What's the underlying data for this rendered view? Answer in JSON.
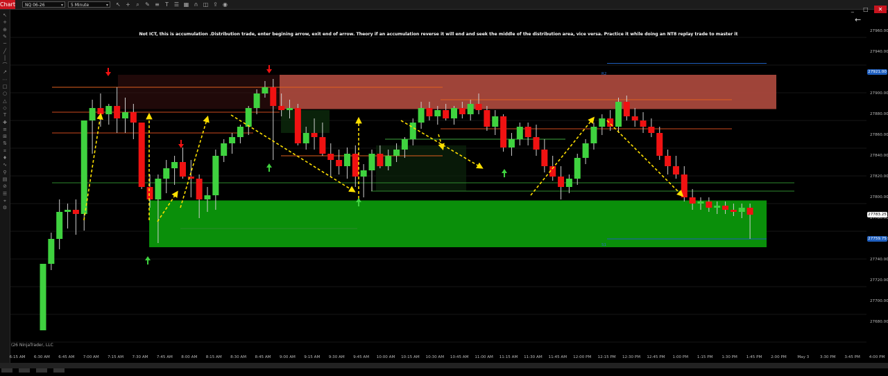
{
  "toolbar": {
    "tab_label": "Chart",
    "instrument": "NQ 06-26",
    "interval": "5 Minute",
    "icons": [
      "cursor-icon",
      "crosshair-icon",
      "zoom-icon",
      "pencil-icon",
      "properties-icon",
      "text-icon",
      "list-icon",
      "grid-icon",
      "magnet-icon",
      "layers-icon",
      "export-icon",
      "camera-icon"
    ]
  },
  "window_buttons": {
    "minimize": "_",
    "maximize": "□",
    "close": "✕"
  },
  "annotation": "Not ICT, this is accumulation .Distribution trade, enter begining arrow, exit end of arrow. Theory if an accumulation reverse it will end and seek the middle of the distribution area, vice versa. Practice it while doing  an NT8 replay trade to  master it",
  "copyright": "(26 NinjaTrader, LLC",
  "level_labels": {
    "r2": "R2",
    "s1": "S1"
  },
  "yaxis": {
    "ticks": [
      "27960.00",
      "27940.00",
      "27900.00",
      "27880.00",
      "27860.00",
      "27840.00",
      "27820.00",
      "27800.00",
      "27780.00",
      "27760.00",
      "27740.00",
      "27720.00",
      "27700.00",
      "27680.00"
    ],
    "price_flags": {
      "r2": {
        "text": "27921.00",
        "color": "#1f5fbf"
      },
      "last": {
        "text": "27783.25",
        "color": "#ffffff"
      },
      "s1": {
        "text": "27759.75",
        "color": "#1f5fbf"
      }
    }
  },
  "xaxis": {
    "labels": [
      "6:15 AM",
      "6:30 AM",
      "6:45 AM",
      "7:00 AM",
      "7:15 AM",
      "7:30 AM",
      "7:45 AM",
      "8:00 AM",
      "8:15 AM",
      "8:30 AM",
      "8:45 AM",
      "9:00 AM",
      "9:15 AM",
      "9:30 AM",
      "9:45 AM",
      "10:00 AM",
      "10:15 AM",
      "10:30 AM",
      "10:45 AM",
      "11:00 AM",
      "11:15 AM",
      "11:30 AM",
      "11:45 AM",
      "12:00 PM",
      "12:15 PM",
      "12:30 PM",
      "12:45 PM",
      "1:00 PM",
      "1:15 PM",
      "1:30 PM",
      "1:45 PM",
      "2:00 PM",
      "May 3",
      "3:30 PM",
      "3:45 PM",
      "4:00 PM"
    ]
  },
  "colors": {
    "up": "#3fd23f",
    "down": "#f01212",
    "zone_red": "#a8483c",
    "zone_green": "#0a8f0a",
    "arrow_yellow": "#ffe000"
  },
  "chart_data": {
    "type": "candlestick",
    "instrument": "NQ 06-26",
    "interval": "5 Minute",
    "ylim": [
      27670,
      27980
    ],
    "candles": [
      {
        "t": "6:30 AM",
        "o": 27672,
        "h": 27736,
        "l": 27672,
        "c": 27736
      },
      {
        "t": "6:35 AM",
        "o": 27736,
        "h": 27766,
        "l": 27730,
        "c": 27760
      },
      {
        "t": "6:40 AM",
        "o": 27760,
        "h": 27798,
        "l": 27750,
        "c": 27786
      },
      {
        "t": "6:45 AM",
        "o": 27786,
        "h": 27794,
        "l": 27770,
        "c": 27788
      },
      {
        "t": "6:50 AM",
        "o": 27788,
        "h": 27798,
        "l": 27764,
        "c": 27784
      },
      {
        "t": "6:55 AM",
        "o": 27784,
        "h": 27846,
        "l": 27768,
        "c": 27874
      },
      {
        "t": "7:00 AM",
        "o": 27874,
        "h": 27894,
        "l": 27842,
        "c": 27886
      },
      {
        "t": "7:05 AM",
        "o": 27886,
        "h": 27900,
        "l": 27868,
        "c": 27880
      },
      {
        "t": "7:10 AM",
        "o": 27880,
        "h": 27890,
        "l": 27870,
        "c": 27888
      },
      {
        "t": "7:15 AM",
        "o": 27888,
        "h": 27906,
        "l": 27862,
        "c": 27876
      },
      {
        "t": "7:20 AM",
        "o": 27876,
        "h": 27896,
        "l": 27862,
        "c": 27882
      },
      {
        "t": "7:25 AM",
        "o": 27882,
        "h": 27890,
        "l": 27856,
        "c": 27872
      },
      {
        "t": "7:30 AM",
        "o": 27872,
        "h": 27872,
        "l": 27808,
        "c": 27810
      },
      {
        "t": "7:35 AM",
        "o": 27810,
        "h": 27822,
        "l": 27790,
        "c": 27798
      },
      {
        "t": "7:40 AM",
        "o": 27798,
        "h": 27822,
        "l": 27756,
        "c": 27818
      },
      {
        "t": "7:45 AM",
        "o": 27818,
        "h": 27836,
        "l": 27804,
        "c": 27828
      },
      {
        "t": "7:50 AM",
        "o": 27828,
        "h": 27840,
        "l": 27812,
        "c": 27834
      },
      {
        "t": "7:55 AM",
        "o": 27834,
        "h": 27848,
        "l": 27818,
        "c": 27820
      },
      {
        "t": "8:00 AM",
        "o": 27820,
        "h": 27836,
        "l": 27800,
        "c": 27818
      },
      {
        "t": "8:05 AM",
        "o": 27818,
        "h": 27822,
        "l": 27780,
        "c": 27798
      },
      {
        "t": "8:10 AM",
        "o": 27798,
        "h": 27810,
        "l": 27786,
        "c": 27802
      },
      {
        "t": "8:15 AM",
        "o": 27802,
        "h": 27846,
        "l": 27788,
        "c": 27840
      },
      {
        "t": "8:20 AM",
        "o": 27840,
        "h": 27856,
        "l": 27834,
        "c": 27852
      },
      {
        "t": "8:25 AM",
        "o": 27852,
        "h": 27862,
        "l": 27842,
        "c": 27858
      },
      {
        "t": "8:30 AM",
        "o": 27858,
        "h": 27870,
        "l": 27852,
        "c": 27868
      },
      {
        "t": "8:35 AM",
        "o": 27868,
        "h": 27888,
        "l": 27860,
        "c": 27886
      },
      {
        "t": "8:40 AM",
        "o": 27886,
        "h": 27904,
        "l": 27880,
        "c": 27900
      },
      {
        "t": "8:45 AM",
        "o": 27900,
        "h": 27912,
        "l": 27896,
        "c": 27906
      },
      {
        "t": "8:50 AM",
        "o": 27906,
        "h": 27914,
        "l": 27836,
        "c": 27888
      },
      {
        "t": "8:55 AM",
        "o": 27888,
        "h": 27900,
        "l": 27878,
        "c": 27884
      },
      {
        "t": "9:00 AM",
        "o": 27884,
        "h": 27894,
        "l": 27876,
        "c": 27886
      },
      {
        "t": "9:05 AM",
        "o": 27886,
        "h": 27890,
        "l": 27850,
        "c": 27852
      },
      {
        "t": "9:10 AM",
        "o": 27852,
        "h": 27868,
        "l": 27846,
        "c": 27862
      },
      {
        "t": "9:15 AM",
        "o": 27862,
        "h": 27876,
        "l": 27846,
        "c": 27858
      },
      {
        "t": "9:20 AM",
        "o": 27858,
        "h": 27872,
        "l": 27840,
        "c": 27842
      },
      {
        "t": "9:25 AM",
        "o": 27842,
        "h": 27852,
        "l": 27820,
        "c": 27836
      },
      {
        "t": "9:30 AM",
        "o": 27836,
        "h": 27846,
        "l": 27822,
        "c": 27830
      },
      {
        "t": "9:35 AM",
        "o": 27830,
        "h": 27848,
        "l": 27818,
        "c": 27842
      },
      {
        "t": "9:40 AM",
        "o": 27842,
        "h": 27850,
        "l": 27810,
        "c": 27820
      },
      {
        "t": "9:45 AM",
        "o": 27820,
        "h": 27832,
        "l": 27800,
        "c": 27826
      },
      {
        "t": "9:50 AM",
        "o": 27826,
        "h": 27846,
        "l": 27806,
        "c": 27842
      },
      {
        "t": "9:55 AM",
        "o": 27842,
        "h": 27850,
        "l": 27828,
        "c": 27830
      },
      {
        "t": "10:00 AM",
        "o": 27830,
        "h": 27846,
        "l": 27826,
        "c": 27840
      },
      {
        "t": "10:05 AM",
        "o": 27840,
        "h": 27852,
        "l": 27834,
        "c": 27846
      },
      {
        "t": "10:10 AM",
        "o": 27846,
        "h": 27858,
        "l": 27838,
        "c": 27856
      },
      {
        "t": "10:15 AM",
        "o": 27856,
        "h": 27876,
        "l": 27850,
        "c": 27872
      },
      {
        "t": "10:20 AM",
        "o": 27872,
        "h": 27892,
        "l": 27866,
        "c": 27886
      },
      {
        "t": "10:25 AM",
        "o": 27886,
        "h": 27892,
        "l": 27874,
        "c": 27878
      },
      {
        "t": "10:30 AM",
        "o": 27878,
        "h": 27888,
        "l": 27870,
        "c": 27884
      },
      {
        "t": "10:35 AM",
        "o": 27884,
        "h": 27890,
        "l": 27874,
        "c": 27876
      },
      {
        "t": "10:40 AM",
        "o": 27876,
        "h": 27888,
        "l": 27870,
        "c": 27886
      },
      {
        "t": "10:45 AM",
        "o": 27886,
        "h": 27892,
        "l": 27876,
        "c": 27880
      },
      {
        "t": "10:50 AM",
        "o": 27880,
        "h": 27894,
        "l": 27874,
        "c": 27890
      },
      {
        "t": "10:55 AM",
        "o": 27890,
        "h": 27900,
        "l": 27880,
        "c": 27884
      },
      {
        "t": "11:00 AM",
        "o": 27884,
        "h": 27888,
        "l": 27864,
        "c": 27868
      },
      {
        "t": "11:05 AM",
        "o": 27868,
        "h": 27884,
        "l": 27860,
        "c": 27878
      },
      {
        "t": "11:10 AM",
        "o": 27878,
        "h": 27880,
        "l": 27844,
        "c": 27848
      },
      {
        "t": "11:15 AM",
        "o": 27848,
        "h": 27862,
        "l": 27840,
        "c": 27856
      },
      {
        "t": "11:20 AM",
        "o": 27856,
        "h": 27872,
        "l": 27850,
        "c": 27868
      },
      {
        "t": "11:25 AM",
        "o": 27868,
        "h": 27872,
        "l": 27850,
        "c": 27858
      },
      {
        "t": "11:30 AM",
        "o": 27858,
        "h": 27870,
        "l": 27840,
        "c": 27846
      },
      {
        "t": "11:35 AM",
        "o": 27846,
        "h": 27856,
        "l": 27824,
        "c": 27830
      },
      {
        "t": "11:40 AM",
        "o": 27830,
        "h": 27840,
        "l": 27816,
        "c": 27820
      },
      {
        "t": "11:45 AM",
        "o": 27820,
        "h": 27830,
        "l": 27798,
        "c": 27810
      },
      {
        "t": "11:50 AM",
        "o": 27810,
        "h": 27822,
        "l": 27804,
        "c": 27818
      },
      {
        "t": "11:55 AM",
        "o": 27818,
        "h": 27842,
        "l": 27812,
        "c": 27838
      },
      {
        "t": "12:00 PM",
        "o": 27838,
        "h": 27856,
        "l": 27832,
        "c": 27852
      },
      {
        "t": "12:05 PM",
        "o": 27852,
        "h": 27872,
        "l": 27846,
        "c": 27868
      },
      {
        "t": "12:10 PM",
        "o": 27868,
        "h": 27880,
        "l": 27860,
        "c": 27876
      },
      {
        "t": "12:15 PM",
        "o": 27876,
        "h": 27884,
        "l": 27864,
        "c": 27868
      },
      {
        "t": "12:20 PM",
        "o": 27868,
        "h": 27896,
        "l": 27862,
        "c": 27892
      },
      {
        "t": "12:25 PM",
        "o": 27892,
        "h": 27898,
        "l": 27874,
        "c": 27878
      },
      {
        "t": "12:30 PM",
        "o": 27878,
        "h": 27886,
        "l": 27868,
        "c": 27874
      },
      {
        "t": "12:35 PM",
        "o": 27874,
        "h": 27882,
        "l": 27862,
        "c": 27868
      },
      {
        "t": "12:40 PM",
        "o": 27868,
        "h": 27876,
        "l": 27858,
        "c": 27862
      },
      {
        "t": "12:45 PM",
        "o": 27862,
        "h": 27868,
        "l": 27836,
        "c": 27840
      },
      {
        "t": "12:50 PM",
        "o": 27840,
        "h": 27846,
        "l": 27822,
        "c": 27830
      },
      {
        "t": "12:55 PM",
        "o": 27830,
        "h": 27840,
        "l": 27818,
        "c": 27822
      },
      {
        "t": "1:00 PM",
        "o": 27822,
        "h": 27830,
        "l": 27796,
        "c": 27800
      },
      {
        "t": "1:05 PM",
        "o": 27800,
        "h": 27808,
        "l": 27788,
        "c": 27794
      },
      {
        "t": "1:10 PM",
        "o": 27794,
        "h": 27800,
        "l": 27788,
        "c": 27796
      },
      {
        "t": "1:15 PM",
        "o": 27796,
        "h": 27800,
        "l": 27786,
        "c": 27790
      },
      {
        "t": "1:20 PM",
        "o": 27790,
        "h": 27796,
        "l": 27784,
        "c": 27792
      },
      {
        "t": "1:25 PM",
        "o": 27792,
        "h": 27796,
        "l": 27784,
        "c": 27788
      },
      {
        "t": "1:30 PM",
        "o": 27788,
        "h": 27794,
        "l": 27782,
        "c": 27786
      },
      {
        "t": "1:35 PM",
        "o": 27786,
        "h": 27794,
        "l": 27780,
        "c": 27790
      },
      {
        "t": "1:40 PM",
        "o": 27790,
        "h": 27794,
        "l": 27760,
        "c": 27783.25
      }
    ]
  }
}
